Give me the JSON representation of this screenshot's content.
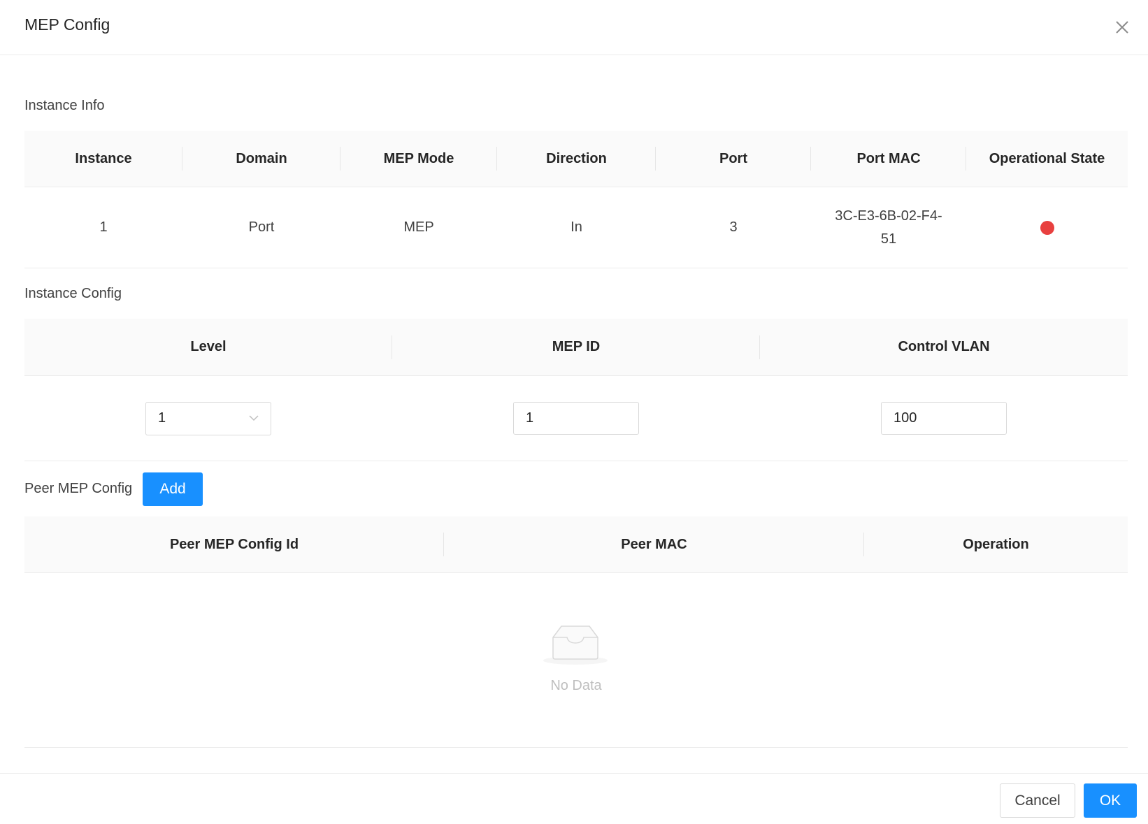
{
  "modal": {
    "title": "MEP Config",
    "close_icon": "close-icon"
  },
  "instance_info": {
    "label": "Instance Info",
    "columns": [
      "Instance",
      "Domain",
      "MEP Mode",
      "Direction",
      "Port",
      "Port MAC",
      "Operational State"
    ],
    "row": {
      "instance": "1",
      "domain": "Port",
      "mep_mode": "MEP",
      "direction": "In",
      "port": "3",
      "port_mac_line1": "3C-E3-6B-02-F4-",
      "port_mac_line2": "51",
      "operational_state_color": "#e8403f"
    }
  },
  "instance_config": {
    "label": "Instance Config",
    "columns": [
      "Level",
      "MEP ID",
      "Control VLAN"
    ],
    "level_value": "1",
    "mep_id_value": "1",
    "control_vlan_value": "100"
  },
  "peer_mep_config": {
    "label": "Peer MEP Config",
    "add_label": "Add",
    "columns": [
      "Peer MEP Config Id",
      "Peer MAC",
      "Operation"
    ],
    "empty_text": "No Data"
  },
  "footer": {
    "cancel_label": "Cancel",
    "ok_label": "OK"
  },
  "colors": {
    "primary": "#1890ff",
    "status_down": "#e8403f"
  }
}
